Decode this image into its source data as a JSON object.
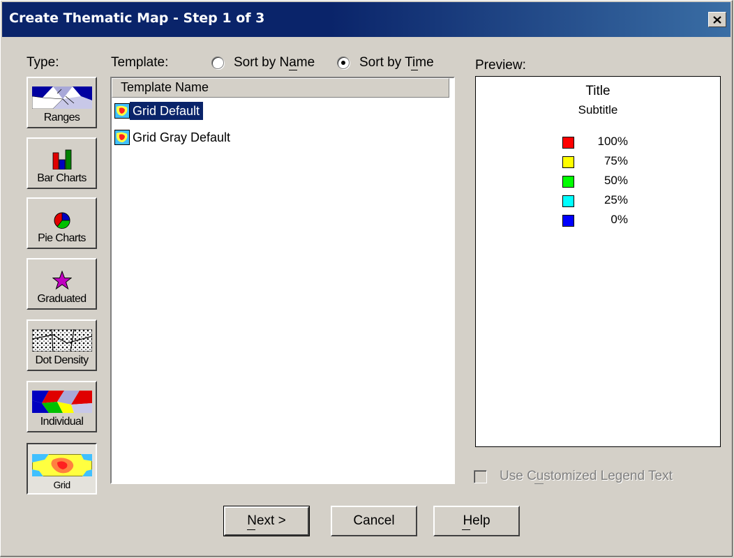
{
  "window": {
    "title": "Create Thematic Map - Step 1 of 3",
    "close_icon": "close-x-icon"
  },
  "type_section": {
    "label": "Type:",
    "buttons": [
      {
        "label": "Ranges",
        "icon": "ranges-pattern-icon",
        "active": false
      },
      {
        "label": "Bar Charts",
        "icon": "bar-chart-icon",
        "active": false
      },
      {
        "label": "Pie Charts",
        "icon": "pie-chart-icon",
        "active": false
      },
      {
        "label": "Graduated",
        "icon": "star-icon",
        "active": false
      },
      {
        "label": "Dot Density",
        "icon": "dot-density-icon",
        "active": false
      },
      {
        "label": "Individual",
        "icon": "individual-pattern-icon",
        "active": false
      },
      {
        "label": "Grid",
        "icon": "grid-icon",
        "active": true
      }
    ]
  },
  "template_section": {
    "label": "Template:",
    "sort_by_name_label": "Sort by Name",
    "sort_by_time_label": "Sort by Time",
    "sort_selected": "time",
    "column_header": "Template Name",
    "items": [
      {
        "name": "Grid Default",
        "icon": "grid-template-icon",
        "selected": true
      },
      {
        "name": "Grid Gray Default",
        "icon": "grid-template-icon",
        "selected": false
      }
    ]
  },
  "preview": {
    "label": "Preview:",
    "title": "Title",
    "subtitle": "Subtitle",
    "legend": [
      {
        "label": "100%",
        "color": "#ff0000"
      },
      {
        "label": "75%",
        "color": "#ffff00"
      },
      {
        "label": "50%",
        "color": "#00ff00"
      },
      {
        "label": "25%",
        "color": "#00ffff"
      },
      {
        "label": "0%",
        "color": "#0000ff"
      }
    ]
  },
  "custom_legend_checkbox": {
    "label": "Use Customized Legend Text",
    "checked": false,
    "enabled": false
  },
  "buttons": {
    "next": "Next >",
    "cancel": "Cancel",
    "help": "Help"
  }
}
